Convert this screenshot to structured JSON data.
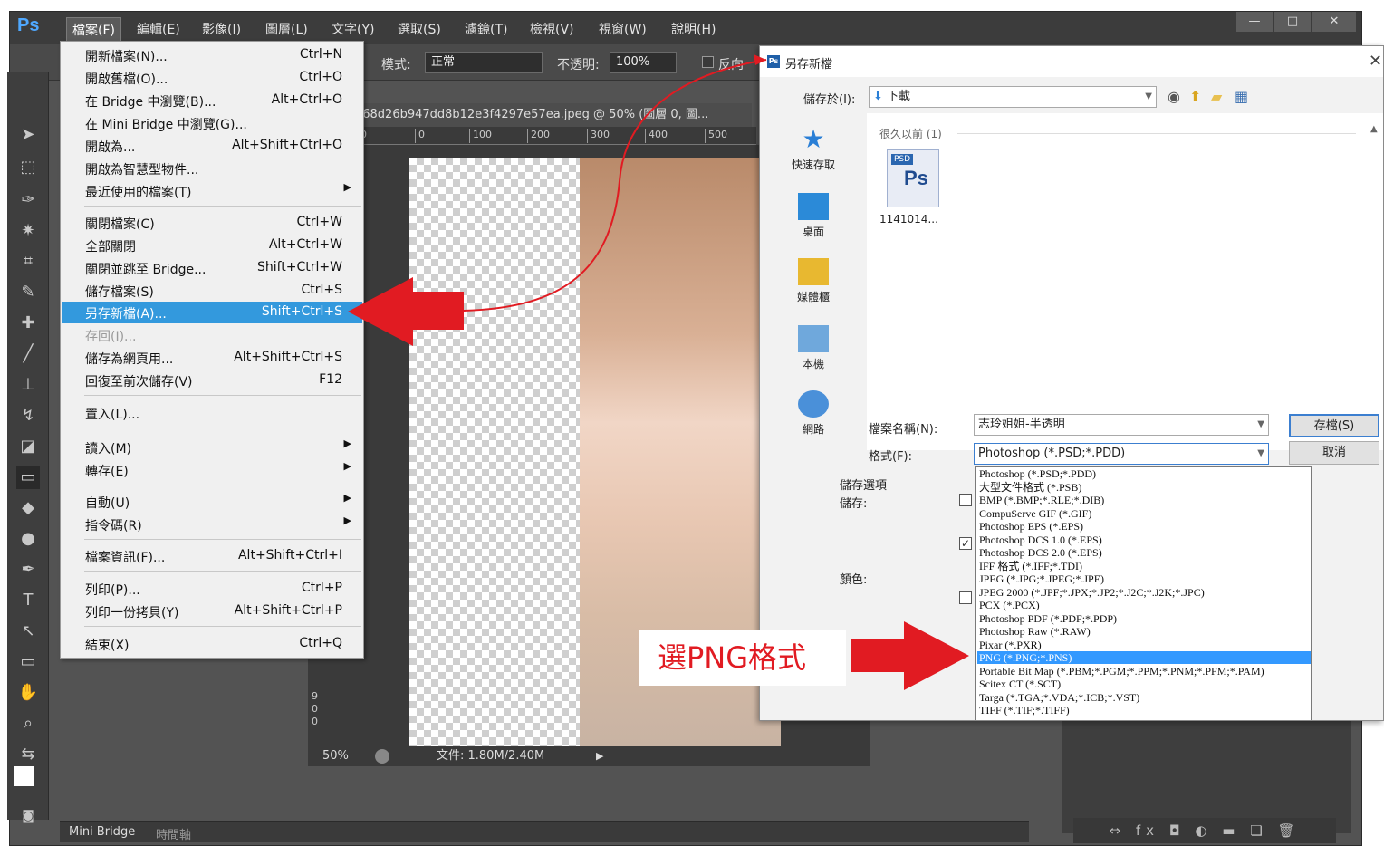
{
  "photoshop": {
    "logo": "Ps",
    "menubar": [
      "檔案(F)",
      "編輯(E)",
      "影像(I)",
      "圖層(L)",
      "文字(Y)",
      "選取(S)",
      "濾鏡(T)",
      "檢視(V)",
      "視窗(W)",
      "說明(H)"
    ],
    "window_controls": [
      "—",
      "□",
      "✕"
    ],
    "options_bar": {
      "mode_label": "模式:",
      "mode_value": "正常",
      "opacity_label": "不透明:",
      "opacity_value": "100%",
      "reverse_label": "反向"
    },
    "doc_tab": "b68d26b947dd8b12e3f4297e57ea.jpeg @ 50% (圖層 0, 圖...",
    "ruler_ticks": [
      "0",
      "0",
      "100",
      "200",
      "300",
      "400",
      "500"
    ],
    "ruler_v_ticks": [
      "9",
      "0",
      "0"
    ],
    "status": {
      "zoom": "50%",
      "doc_size": "文件: 1.80M/2.40M"
    },
    "bottom_tabs": [
      "Mini Bridge",
      "時間軸"
    ]
  },
  "file_menu": [
    {
      "label": "開新檔案(N)...",
      "shortcut": "Ctrl+N"
    },
    {
      "label": "開啟舊檔(O)...",
      "shortcut": "Ctrl+O"
    },
    {
      "label": "在 Bridge 中瀏覽(B)...",
      "shortcut": "Alt+Ctrl+O"
    },
    {
      "label": "在 Mini Bridge 中瀏覽(G)...",
      "shortcut": ""
    },
    {
      "label": "開啟為...",
      "shortcut": "Alt+Shift+Ctrl+O"
    },
    {
      "label": "開啟為智慧型物件...",
      "shortcut": ""
    },
    {
      "label": "最近使用的檔案(T)",
      "shortcut": ""
    },
    {
      "label": "關閉檔案(C)",
      "shortcut": "Ctrl+W"
    },
    {
      "label": "全部關閉",
      "shortcut": "Alt+Ctrl+W"
    },
    {
      "label": "關閉並跳至 Bridge...",
      "shortcut": "Shift+Ctrl+W"
    },
    {
      "label": "儲存檔案(S)",
      "shortcut": "Ctrl+S"
    },
    {
      "label": "另存新檔(A)...",
      "shortcut": "Shift+Ctrl+S"
    },
    {
      "label": "存回(I)...",
      "shortcut": ""
    },
    {
      "label": "儲存為網頁用...",
      "shortcut": "Alt+Shift+Ctrl+S"
    },
    {
      "label": "回復至前次儲存(V)",
      "shortcut": "F12"
    },
    {
      "label": "置入(L)...",
      "shortcut": ""
    },
    {
      "label": "讀入(M)",
      "shortcut": ""
    },
    {
      "label": "轉存(E)",
      "shortcut": ""
    },
    {
      "label": "自動(U)",
      "shortcut": ""
    },
    {
      "label": "指令碼(R)",
      "shortcut": ""
    },
    {
      "label": "檔案資訊(F)...",
      "shortcut": "Alt+Shift+Ctrl+I"
    },
    {
      "label": "列印(P)...",
      "shortcut": "Ctrl+P"
    },
    {
      "label": "列印一份拷貝(Y)",
      "shortcut": "Alt+Shift+Ctrl+P"
    },
    {
      "label": "結束(X)",
      "shortcut": "Ctrl+Q"
    }
  ],
  "save_dialog": {
    "title": "另存新檔",
    "save_in_label": "儲存於(I):",
    "save_in_value": "下載",
    "places": [
      "快速存取",
      "桌面",
      "媒體櫃",
      "本機",
      "網路"
    ],
    "group_header": "很久以前 (1)",
    "file_badge": "PSD",
    "file_name": "1141014...",
    "filename_label": "檔案名稱(N):",
    "filename_value": "志玲姐姐-半透明",
    "format_label": "格式(F):",
    "format_value": "Photoshop (*.PSD;*.PDD)",
    "save_button": "存檔(S)",
    "cancel_button": "取消",
    "save_options_label": "儲存選項",
    "save_label": "儲存:",
    "color_label": "顏色:",
    "format_options": [
      "Photoshop (*.PSD;*.PDD)",
      "大型文件格式 (*.PSB)",
      "BMP (*.BMP;*.RLE;*.DIB)",
      "CompuServe GIF (*.GIF)",
      "Photoshop EPS (*.EPS)",
      "Photoshop DCS 1.0 (*.EPS)",
      "Photoshop DCS 2.0 (*.EPS)",
      "IFF 格式 (*.IFF;*.TDI)",
      "JPEG (*.JPG;*.JPEG;*.JPE)",
      "JPEG 2000 (*.JPF;*.JPX;*.JP2;*.J2C;*.J2K;*.JPC)",
      "PCX (*.PCX)",
      "Photoshop PDF (*.PDF;*.PDP)",
      "Photoshop Raw (*.RAW)",
      "Pixar (*.PXR)",
      "PNG (*.PNG;*.PNS)",
      "Portable Bit Map (*.PBM;*.PGM;*.PPM;*.PNM;*.PFM;*.PAM)",
      "Scitex CT (*.SCT)",
      "Targa (*.TGA;*.VDA;*.ICB;*.VST)",
      "TIFF (*.TIF;*.TIFF)"
    ],
    "selected_format": "PNG (*.PNG;*.PNS)"
  },
  "annotation": {
    "label": "選PNG格式",
    "color": "#e11b22"
  },
  "colors": {
    "menu_highlight": "#3399dd",
    "list_highlight": "#3399ff",
    "ps_dark": "#535353"
  }
}
